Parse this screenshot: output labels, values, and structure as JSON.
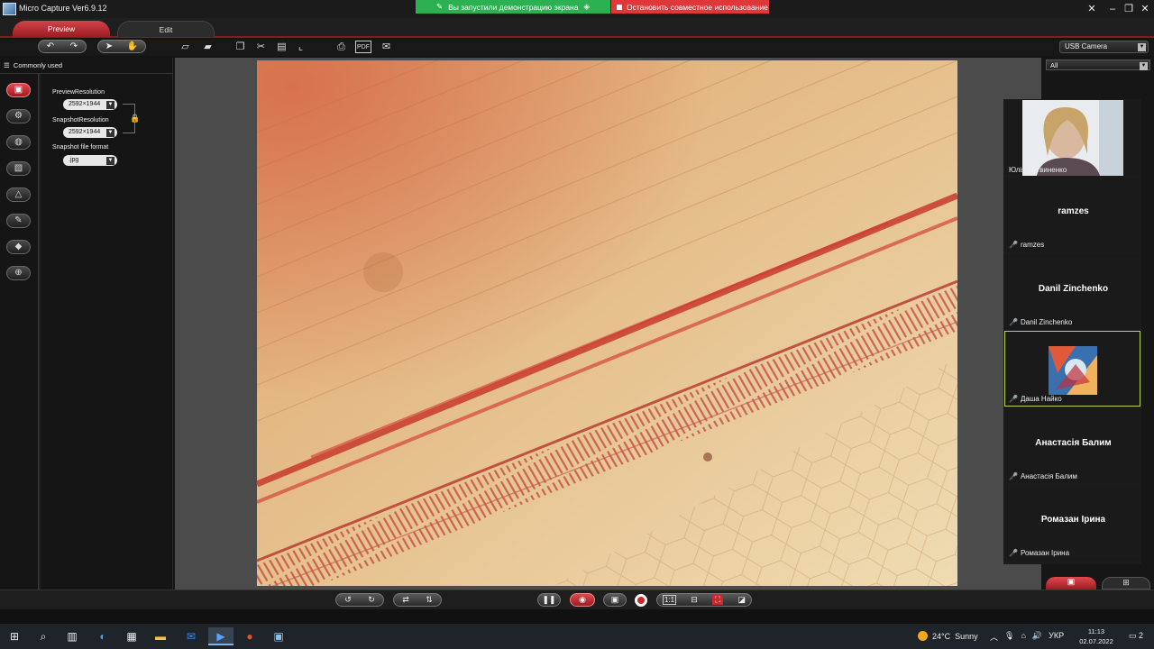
{
  "window": {
    "title": "Micro Capture Ver6.9.12"
  },
  "share_banner": {
    "message": "Вы запустили демонстрацию экрана",
    "stop_label": "Остановить совместное использование"
  },
  "tabs": [
    {
      "label": "Preview"
    },
    {
      "label": "Edit"
    }
  ],
  "toolbar": {
    "camera_value": "USB Camera",
    "pdf_label": "PDF"
  },
  "left_panel": {
    "header": "Commonly used",
    "preview_resolution_label": "PreviewResolution",
    "preview_resolution_value": "2592×1944",
    "snapshot_resolution_label": "SnapshotResolution",
    "snapshot_resolution_value": "2592×1944",
    "file_format_label": "Snapshot file format",
    "file_format_value": ".jpg"
  },
  "right_panel": {
    "filter_value": "All"
  },
  "participants": [
    {
      "label": "Юлія Литвиненко",
      "video": true
    },
    {
      "name": "ramzes",
      "label": "ramzes"
    },
    {
      "name": "Danil Zinchenko",
      "label": "Danil Zinchenko"
    },
    {
      "label": "Даша Найко",
      "avatar": true,
      "active": true
    },
    {
      "name": "Анастасія Балим",
      "label": "Анастасія Балим"
    },
    {
      "name": "Ромазан Ірина",
      "label": "Ромазан Ірина"
    }
  ],
  "controls": {
    "ratio_label": "1:1"
  },
  "taskbar": {
    "weather_temp": "24°C",
    "weather_text": "Sunny",
    "language": "УКР",
    "time": "11:13",
    "date": "02.07.2022",
    "notifications": "2"
  },
  "colors": {
    "accent_red": "#c8282e",
    "share_green": "#2bb152",
    "share_red": "#e0383a",
    "active_border": "#b7d44a"
  }
}
